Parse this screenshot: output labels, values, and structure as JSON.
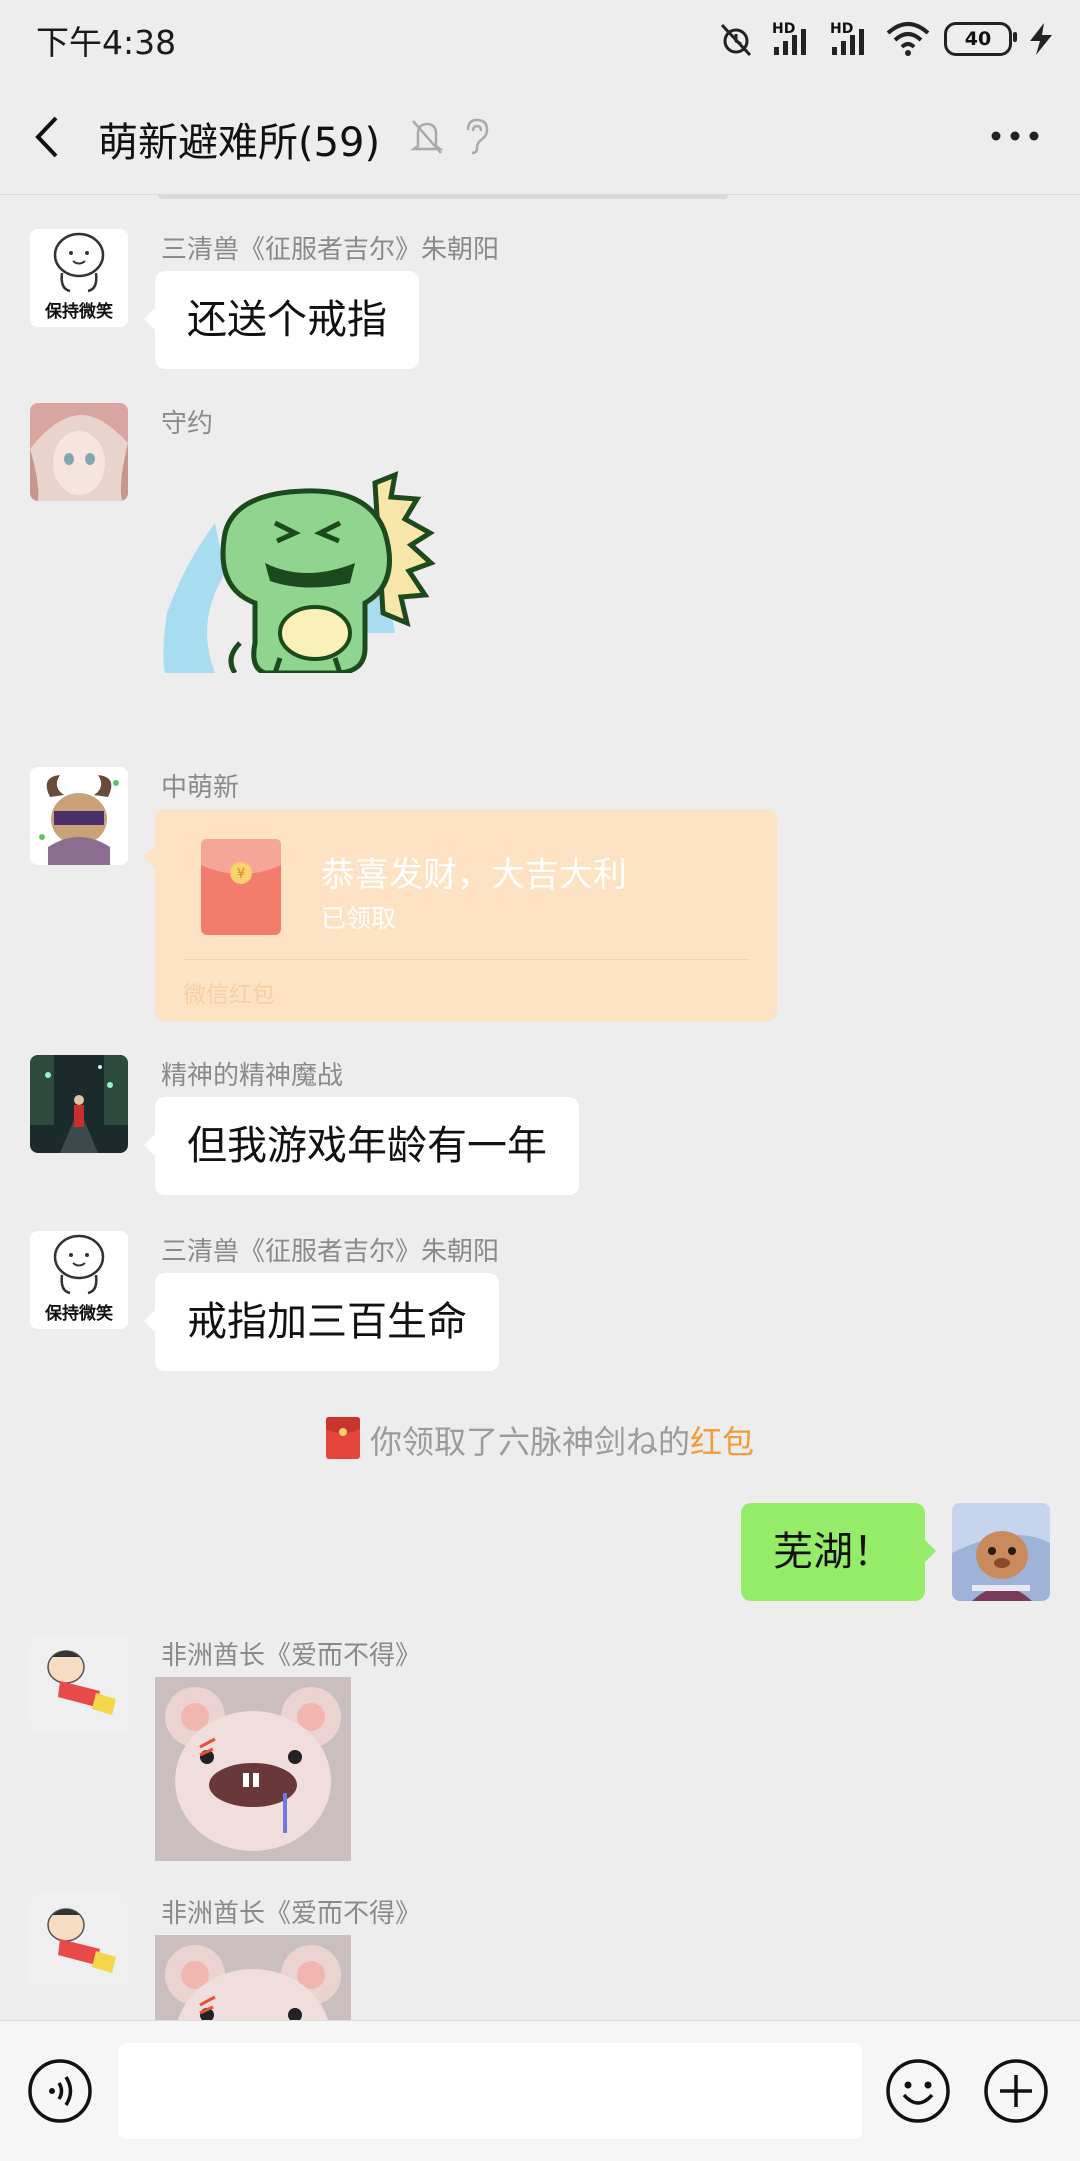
{
  "status_bar": {
    "time": "下午4:38",
    "network_1": "HD",
    "network_2": "HD",
    "battery": "40"
  },
  "header": {
    "title": "萌新避难所(59)",
    "icons": [
      "back-arrow-icon",
      "mute-bell-icon",
      "ear-icon",
      "more-dots-icon"
    ]
  },
  "messages": [
    {
      "sender": "三清兽《征服者吉尔》朱朝阳",
      "text": "还送个戒指",
      "avatar_text": "保持微笑"
    },
    {
      "sender": "守约",
      "sticker": "crying-dinosaur-sticker"
    },
    {
      "sender": "中萌新",
      "red_packet": {
        "title": "恭喜发财，大吉大利",
        "status": "已领取",
        "footer": "微信红包"
      }
    },
    {
      "sender": "精神的精神魔战",
      "text": "但我游戏年龄有一年"
    },
    {
      "sender": "三清兽《征服者吉尔》朱朝阳",
      "text": "戒指加三百生命",
      "avatar_text": "保持微笑"
    },
    {
      "sender": "非洲酋长《爱而不得》",
      "sticker": "hamster-sticker"
    },
    {
      "sender": "非洲酋长《爱而不得》",
      "sticker": "hamster-sticker"
    }
  ],
  "system_notice": {
    "prefix": "你领取了六脉神剑ね的",
    "link": "红包"
  },
  "self_message": {
    "text": "芜湖！"
  },
  "input_bar": {
    "placeholder": ""
  },
  "colors": {
    "background": "#ededed",
    "self_bubble": "#95ec69",
    "red_packet": "#fde2c3",
    "link": "#f29b38"
  }
}
